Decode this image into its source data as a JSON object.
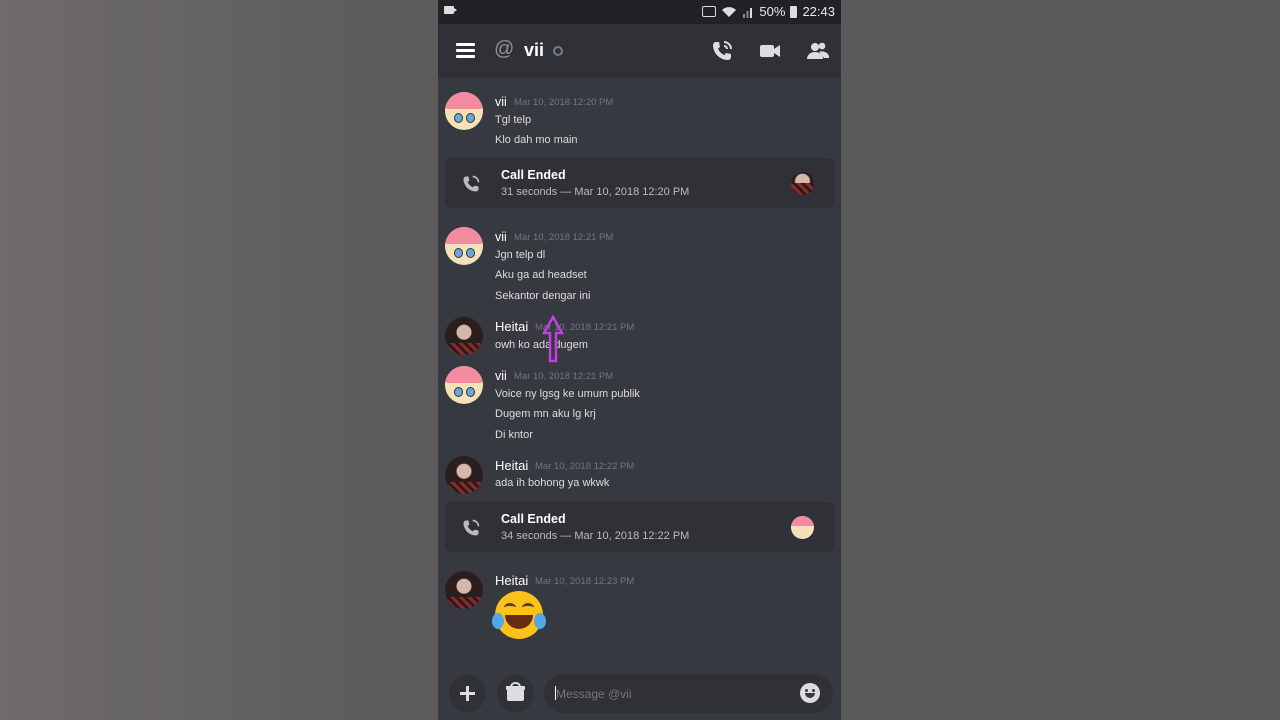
{
  "status_bar": {
    "battery": "50%",
    "time": "22:43"
  },
  "header": {
    "channel_icon": "at-icon",
    "channel_name": "vii"
  },
  "messages": [
    {
      "author": "vii",
      "timestamp": "Mar 10, 2018 12:20 PM",
      "lines": [
        "Tgl telp",
        "Klo dah mo main"
      ]
    },
    {
      "type": "call",
      "title": "Call Ended",
      "detail": "31 seconds — Mar 10, 2018 12:20 PM"
    },
    {
      "author": "vii",
      "timestamp": "Mar 10, 2018 12:21 PM",
      "lines": [
        "Jgn telp dl",
        "Aku ga ad headset",
        "Sekantor dengar ini"
      ]
    },
    {
      "author": "Heitai",
      "timestamp": "Mar 10, 2018 12:21 PM",
      "lines": [
        "owh ko ada dugem"
      ]
    },
    {
      "author": "vii",
      "timestamp": "Mar 10, 2018 12:21 PM",
      "lines": [
        "Voice ny lgsg ke umum publik",
        "Dugem mn aku lg krj",
        "Di kntor"
      ]
    },
    {
      "author": "Heitai",
      "timestamp": "Mar 10, 2018 12:22 PM",
      "lines": [
        "ada ih bohong ya wkwk"
      ]
    },
    {
      "type": "call",
      "title": "Call Ended",
      "detail": "34 seconds — Mar 10, 2018 12:22 PM"
    },
    {
      "author": "Heitai",
      "timestamp": "Mar 10, 2018 12:23 PM",
      "emoji": "joy-emoji"
    }
  ],
  "composer": {
    "placeholder": "Message @vii"
  },
  "colors": {
    "background": "#36393f",
    "header": "#2f3136",
    "status_offline": "#747f8d",
    "call_card": "#2f3136"
  }
}
